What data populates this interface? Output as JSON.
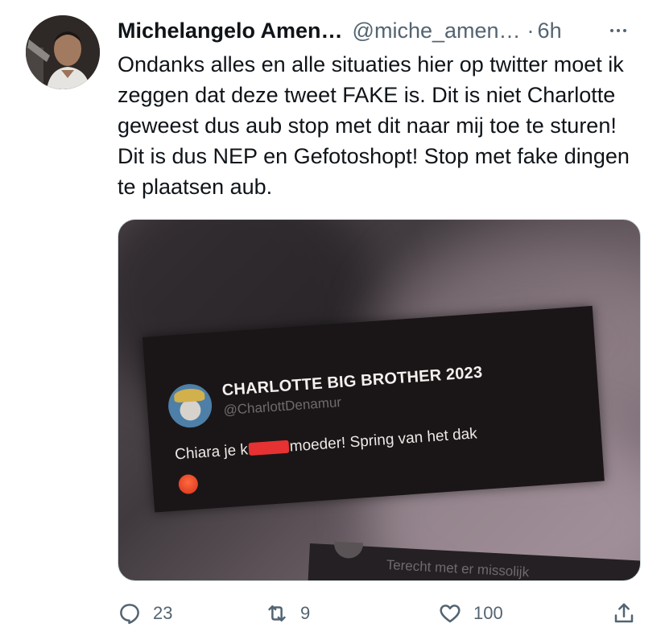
{
  "tweet": {
    "author_name": "Michelangelo Amen…",
    "handle": "@miche_amen…",
    "separator": "·",
    "time": "6h",
    "text": "Ondanks alles en alle situaties hier op twitter moet ik zeggen dat deze tweet FAKE is. Dit is niet Charlotte geweest dus aub stop met dit naar mij toe te sturen! Dit is dus NEP en Gefotoshopt! Stop met fake dingen te plaatsen aub.",
    "more_icon": "more-horizontal-icon"
  },
  "media": {
    "card_name": "CHARLOTTE BIG BROTHER 2023",
    "card_handle": "@CharlottDenamur",
    "card_text_before": "Chiara je k",
    "card_text_after": "moeder! Spring van het dak",
    "card2_text": "Terecht met er missolijk"
  },
  "actions": {
    "reply": {
      "icon": "reply-icon",
      "count": "23"
    },
    "retweet": {
      "icon": "retweet-icon",
      "count": "9"
    },
    "like": {
      "icon": "heart-icon",
      "count": "100"
    },
    "share": {
      "icon": "share-icon"
    }
  },
  "colors": {
    "text_primary": "#0f1419",
    "text_secondary": "#536471",
    "redaction": "#e63232"
  }
}
